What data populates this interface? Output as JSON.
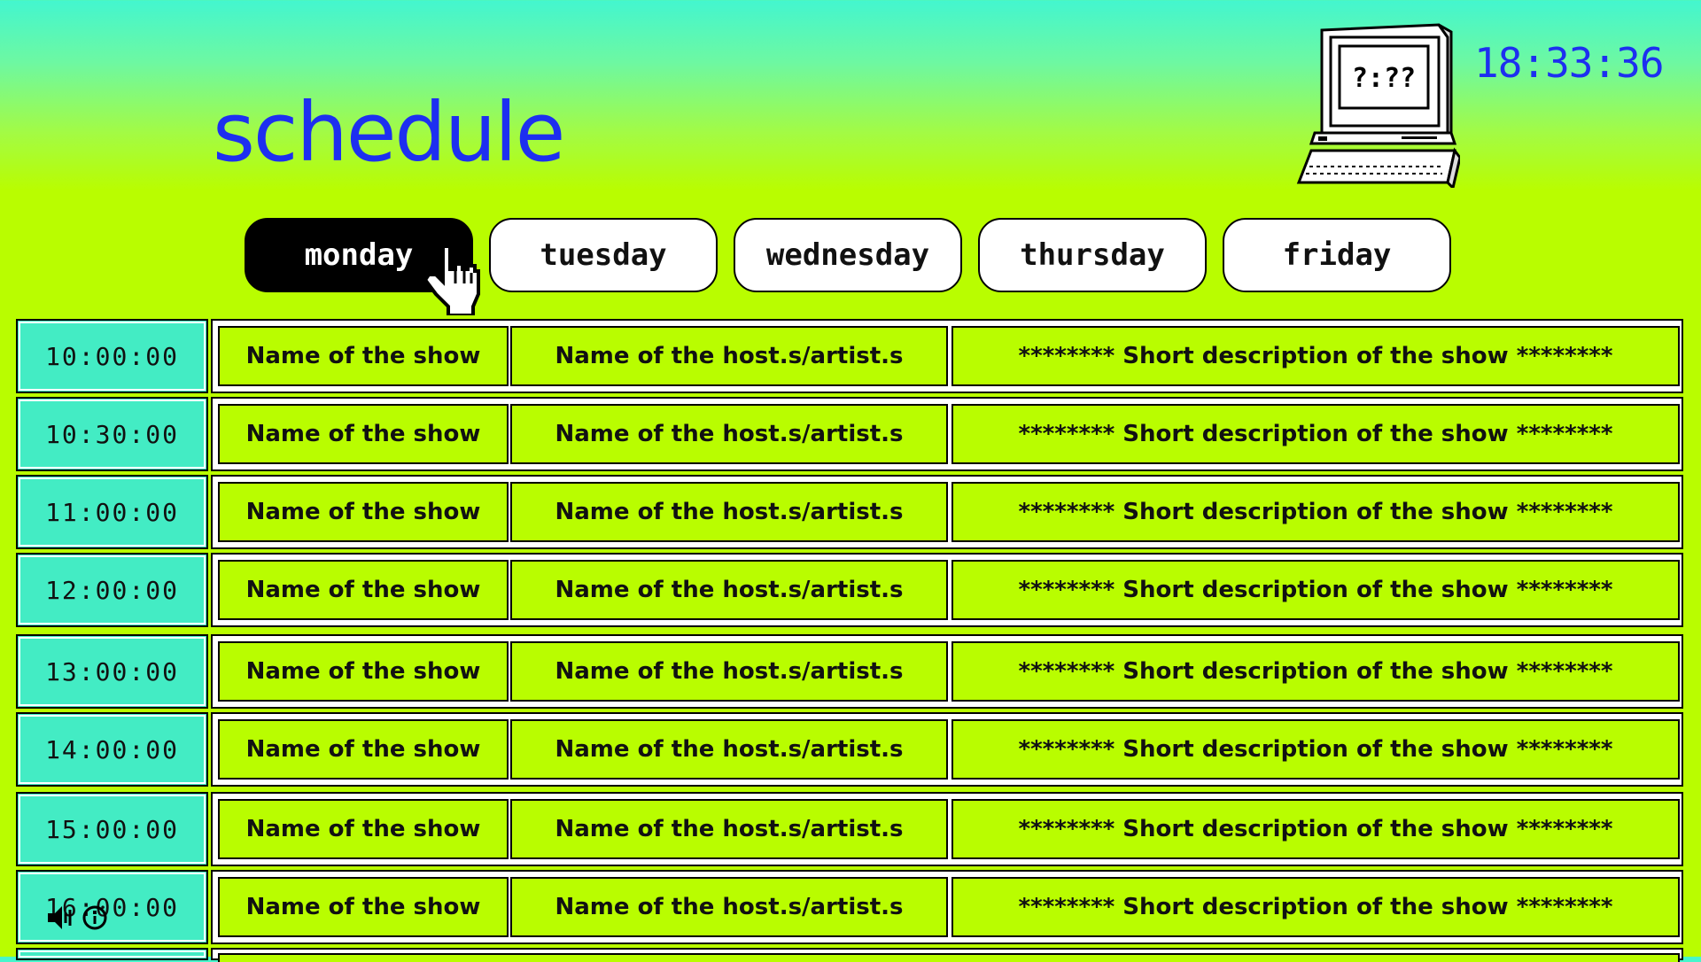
{
  "header": {
    "title": "schedule",
    "clock": "18:33:36",
    "computer_screen_text": "?:??"
  },
  "tabs": [
    {
      "label": "monday",
      "active": true
    },
    {
      "label": "tuesday",
      "active": false
    },
    {
      "label": "wednesday",
      "active": false
    },
    {
      "label": "thursday",
      "active": false
    },
    {
      "label": "friday",
      "active": false
    }
  ],
  "schedule": [
    {
      "time": "10:00:00",
      "show": "Name of the show",
      "host": "Name of the host.s/artist.s",
      "description": "******** Short description of the show ********"
    },
    {
      "time": "10:30:00",
      "show": "Name of the show",
      "host": "Name of the host.s/artist.s",
      "description": "******** Short description of the show ********"
    },
    {
      "time": "11:00:00",
      "show": "Name of the show",
      "host": "Name of the host.s/artist.s",
      "description": "******** Short description of the show ********"
    },
    {
      "time": "12:00:00",
      "show": "Name of the show",
      "host": "Name of the host.s/artist.s",
      "description": "******** Short description of the show ********"
    },
    {
      "time": "13:00:00",
      "show": "Name of the show",
      "host": "Name of the host.s/artist.s",
      "description": "******** Short description of the show ********"
    },
    {
      "time": "14:00:00",
      "show": "Name of the show",
      "host": "Name of the host.s/artist.s",
      "description": "******** Short description of the show ********"
    },
    {
      "time": "15:00:00",
      "show": "Name of the show",
      "host": "Name of the host.s/artist.s",
      "description": "******** Short description of the show ********"
    },
    {
      "time": "16:00:00",
      "show": "Name of the show",
      "host": "Name of the host.s/artist.s",
      "description": "******** Short description of the show ********"
    }
  ],
  "icons": {
    "computer": "retro-computer-icon",
    "cursor": "hand-pointer-icon",
    "volume": "speaker-icon",
    "info": "info-circle-icon"
  },
  "colors": {
    "accent_blue": "#1d2ff0",
    "lime": "#b9fd00",
    "aqua": "#43ecc4",
    "active_tab": "#000000"
  }
}
